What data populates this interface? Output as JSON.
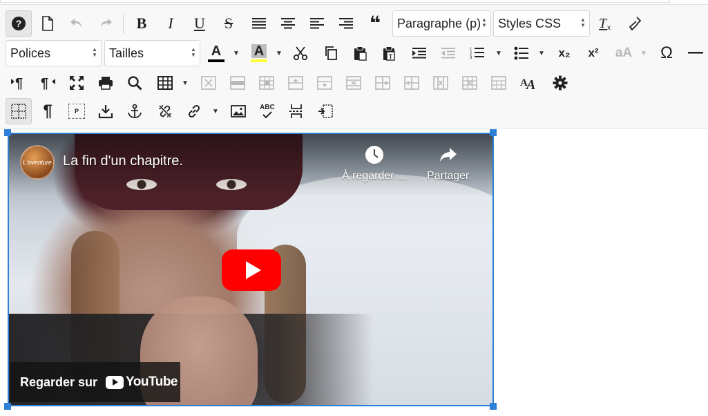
{
  "editor": {
    "block_format": "Paragraphe (p)",
    "css_styles": "Styles CSS",
    "fonts": "Polices",
    "sizes": "Tailles",
    "accent_color": "#2d7fd8",
    "text_color_bar": "#000000",
    "bg_color_bar": "#ffff33"
  },
  "toolbar": {
    "bold_label": "B",
    "italic_label": "I",
    "underline_label": "U",
    "strike_label": "S",
    "text_color_label": "A",
    "bg_color_label": "A",
    "subscript_label": "x₂",
    "superscript_label": "x²",
    "case_label": "aA",
    "omega_label": "Ω",
    "paragraph_mark": "¶",
    "style_label": "A",
    "p_label": "P",
    "spell_label": "ABC",
    "quote_label": "❝"
  },
  "video": {
    "title": "La fin d'un chapitre.",
    "channel_avatar_text": "L'aventure",
    "watch_later": "À regarder ...",
    "share": "Partager",
    "watch_on": "Regarder sur",
    "youtube": "YouTube",
    "play_color": "#ff0000"
  }
}
